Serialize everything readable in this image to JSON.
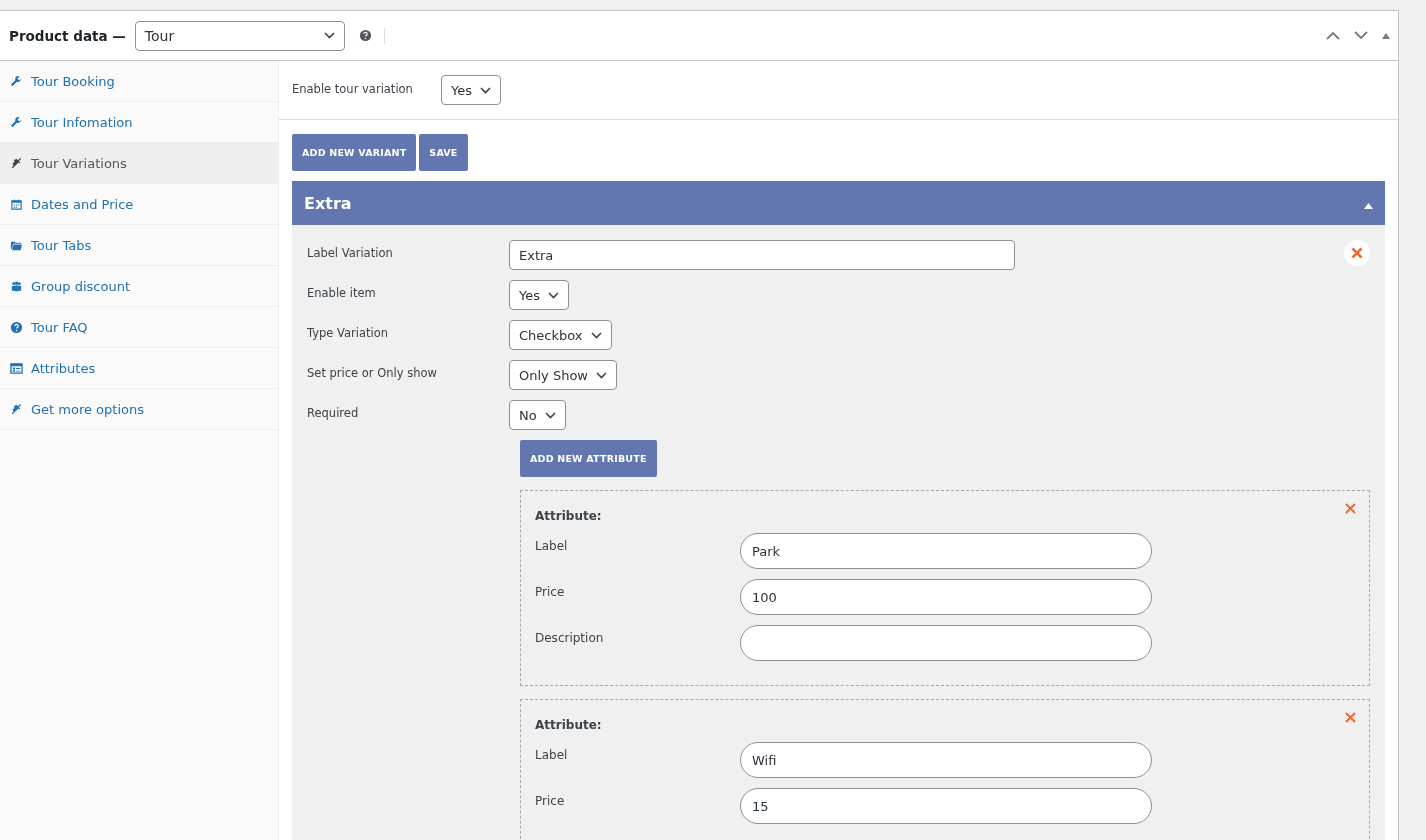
{
  "header": {
    "title": "Product data —",
    "product_type": "Tour"
  },
  "tabs": [
    {
      "label": "Tour Booking",
      "kind": "wrench",
      "selected": false
    },
    {
      "label": "Tour Infomation",
      "kind": "wrench",
      "selected": false
    },
    {
      "label": "Tour Variations",
      "kind": "plug",
      "selected": true
    },
    {
      "label": "Dates and Price",
      "kind": "calendar",
      "selected": false
    },
    {
      "label": "Tour Tabs",
      "kind": "folder",
      "selected": false
    },
    {
      "label": "Group discount",
      "kind": "group",
      "selected": false
    },
    {
      "label": "Tour FAQ",
      "kind": "help",
      "selected": false
    },
    {
      "label": "Attributes",
      "kind": "list",
      "selected": false
    },
    {
      "label": "Get more options",
      "kind": "plug",
      "selected": false
    }
  ],
  "enable_variation": {
    "label": "Enable tour variation",
    "value": "Yes"
  },
  "buttons": [
    "ADD NEW VARIANT",
    "SAVE"
  ],
  "variation": {
    "title": "Extra",
    "expanded": true,
    "fields": [
      {
        "label": "Label Variation",
        "kind": "text",
        "value": "Extra"
      },
      {
        "label": "Enable item",
        "kind": "select",
        "value": "Yes"
      },
      {
        "label": "Type Variation",
        "kind": "select",
        "value": "Checkbox"
      },
      {
        "label": "Set price or Only show",
        "kind": "select",
        "value": "Only Show"
      },
      {
        "label": "Required",
        "kind": "select",
        "value": "No"
      }
    ],
    "add_attribute_button": "ADD NEW ATTRIBUTE",
    "attributes": [
      {
        "heading": "Attribute:",
        "fields": [
          {
            "label": "Label",
            "value": "Park"
          },
          {
            "label": "Price",
            "value": "100"
          },
          {
            "label": "Description"
          }
        ]
      },
      {
        "heading": "Attribute:",
        "fields": [
          {
            "label": "Label",
            "value": "Wifi"
          },
          {
            "label": "Price",
            "value": "15"
          }
        ]
      }
    ]
  }
}
